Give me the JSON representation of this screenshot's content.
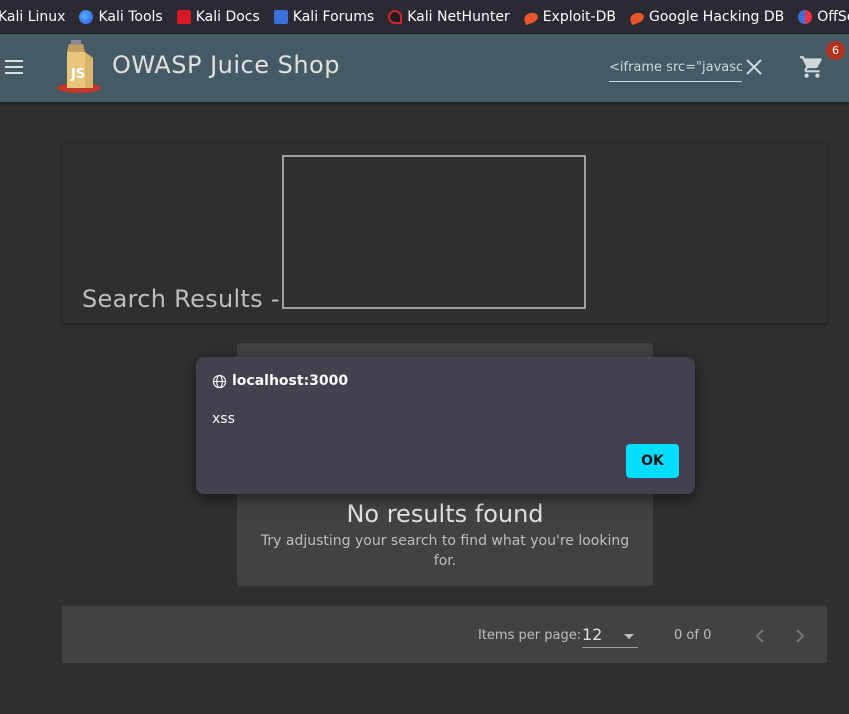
{
  "bookmarks": [
    {
      "label": "Kali Linux",
      "icon": "kali-icon"
    },
    {
      "label": "Kali Tools",
      "icon": "kali-tools-icon"
    },
    {
      "label": "Kali Docs",
      "icon": "kali-docs-icon"
    },
    {
      "label": "Kali Forums",
      "icon": "kali-forums-icon"
    },
    {
      "label": "Kali NetHunter",
      "icon": "nethunter-icon"
    },
    {
      "label": "Exploit-DB",
      "icon": "exploit-db-icon"
    },
    {
      "label": "Google Hacking DB",
      "icon": "ghdb-icon"
    },
    {
      "label": "OffSec",
      "icon": "offsec-icon"
    }
  ],
  "toolbar": {
    "title": "OWASP Juice Shop",
    "search_value": "<iframe src=\"javascript:alert('xss')\">",
    "cart_count": "6",
    "bg_color": "#455a64"
  },
  "results": {
    "heading": "Search Results -"
  },
  "no_results": {
    "title": "No results found",
    "text": "Try adjusting your search to find what you're looking for."
  },
  "paginator": {
    "items_label": "Items per page:",
    "items_value": "12",
    "range": "0 of 0"
  },
  "dialog": {
    "origin": "localhost:3000",
    "message": "xss",
    "ok_label": "OK",
    "accent_color": "#00ddff"
  }
}
